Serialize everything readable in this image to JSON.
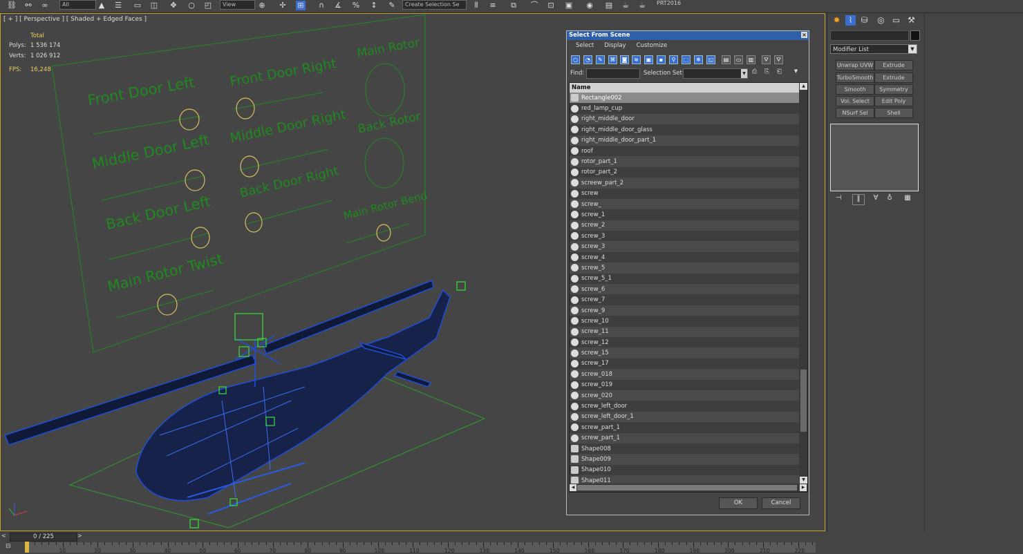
{
  "toolbar": {
    "combo_all": "All",
    "combo_view": "View",
    "combo_selset": "Create Selection Se",
    "prt_label": "PRT2016",
    "icons": [
      "link-icon",
      "unlink-icon",
      "bind-icon",
      "select-icon",
      "select-by-name-icon",
      "rect-region-icon",
      "window-crossing-icon",
      "move-icon",
      "rotate-icon",
      "scale-icon",
      "snap-icon",
      "angle-snap-icon",
      "percent-snap-icon",
      "spinner-snap-icon",
      "edit-named-sel-icon",
      "mirror-icon",
      "align-icon",
      "layer-icon",
      "curve-editor-icon",
      "schematic-icon",
      "material-editor-icon",
      "render-setup-icon",
      "render-frame-icon",
      "render-icon"
    ]
  },
  "viewport": {
    "label": "[ + ] [ Perspective ] [ Shaded + Edged Faces ]",
    "stats": {
      "header": "Total",
      "rows": [
        {
          "key": "Polys:",
          "value": "1 536 174"
        },
        {
          "key": "Verts:",
          "value": "1 026 912"
        }
      ],
      "fps_key": "FPS:",
      "fps_value": "16,248"
    },
    "panel_labels": {
      "front_door_left": "Front Door Left",
      "front_door_right": "Front Door Right",
      "main_rotor": "Main Rotor",
      "middle_door_left": "Middle Door Left",
      "middle_door_right": "Middle Door Right",
      "back_rotor": "Back Rotor",
      "back_door_left": "Back Door Left",
      "back_door_right": "Back Door Right",
      "main_rotor_bend": "Main Rotor Bend",
      "main_rotor_twist": "Main Rotor Twist"
    },
    "colors": {
      "panel": "#1f8a1f",
      "circle": "#d8c060",
      "wire": "#1f4fd8",
      "ground": "#2aa02a"
    }
  },
  "dialog": {
    "title": "Select From Scene",
    "close": "×",
    "menu": [
      "Select",
      "Display",
      "Customize"
    ],
    "find_label": "Find:",
    "selset_label": "Selection Set:",
    "column_name": "Name",
    "items": [
      {
        "name": "Rectangle002",
        "icon": "shape",
        "selected": true
      },
      {
        "name": "red_lamp_cup",
        "icon": "geo"
      },
      {
        "name": "right_middle_door",
        "icon": "geo"
      },
      {
        "name": "right_middle_door_glass",
        "icon": "geo"
      },
      {
        "name": "right_middle_door_part_1",
        "icon": "geo"
      },
      {
        "name": "roof",
        "icon": "geo"
      },
      {
        "name": "rotor_part_1",
        "icon": "geo"
      },
      {
        "name": "rotor_part_2",
        "icon": "geo"
      },
      {
        "name": "screew_part_2",
        "icon": "geo"
      },
      {
        "name": "screw",
        "icon": "geo"
      },
      {
        "name": "screw_",
        "icon": "geo"
      },
      {
        "name": "screw_1",
        "icon": "geo"
      },
      {
        "name": "screw_2",
        "icon": "geo"
      },
      {
        "name": "screw_3",
        "icon": "geo"
      },
      {
        "name": "screw_3",
        "icon": "geo"
      },
      {
        "name": "screw_4",
        "icon": "geo"
      },
      {
        "name": "screw_5",
        "icon": "geo"
      },
      {
        "name": "screw_5_1",
        "icon": "geo"
      },
      {
        "name": "screw_6",
        "icon": "geo"
      },
      {
        "name": "screw_7",
        "icon": "geo"
      },
      {
        "name": "screw_9",
        "icon": "geo"
      },
      {
        "name": "screw_10",
        "icon": "geo"
      },
      {
        "name": "screw_11",
        "icon": "geo"
      },
      {
        "name": "screw_12",
        "icon": "geo"
      },
      {
        "name": "screw_15",
        "icon": "geo"
      },
      {
        "name": "screw_17",
        "icon": "geo"
      },
      {
        "name": "screw_018",
        "icon": "geo"
      },
      {
        "name": "screw_019",
        "icon": "geo"
      },
      {
        "name": "screw_020",
        "icon": "geo"
      },
      {
        "name": "screw_left_door",
        "icon": "geo"
      },
      {
        "name": "screw_left_door_1",
        "icon": "geo"
      },
      {
        "name": "screw_part_1",
        "icon": "geo"
      },
      {
        "name": "screw_part_1",
        "icon": "geo"
      },
      {
        "name": "Shape008",
        "icon": "shape"
      },
      {
        "name": "Shape009",
        "icon": "shape"
      },
      {
        "name": "Shape010",
        "icon": "shape"
      },
      {
        "name": "Shape011",
        "icon": "shape"
      }
    ],
    "ok": "OK",
    "cancel": "Cancel"
  },
  "command_panel": {
    "modifier_list": "Modifier List",
    "buttons": [
      "Unwrap UVW",
      "Extrude",
      "TurboSmooth",
      "Extrude",
      "Smooth",
      "Symmetry",
      "Vol. Select",
      "Edit Poly",
      "NSurf Sel",
      "Shell"
    ]
  },
  "timeline": {
    "counter": "0 / 225",
    "prev": "<",
    "next": ">",
    "ticks": [
      "10",
      "20",
      "30",
      "40",
      "50",
      "60",
      "70",
      "80",
      "90",
      "100",
      "110",
      "120",
      "130",
      "140",
      "150",
      "160",
      "170",
      "180",
      "190",
      "200",
      "210",
      "220"
    ]
  }
}
